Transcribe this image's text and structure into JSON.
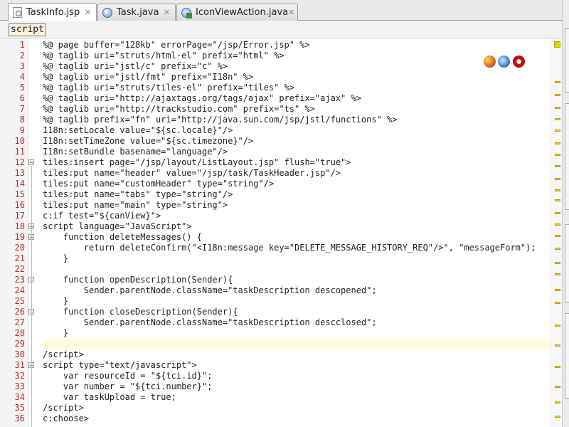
{
  "tabs": [
    {
      "label": "TaskInfo.jsp",
      "icon": "jsp-file-icon",
      "active": true
    },
    {
      "label": "Task.java",
      "icon": "java-class-icon",
      "active": false
    },
    {
      "label": "IconViewAction.java",
      "icon": "java-action-icon",
      "active": false
    }
  ],
  "close_glyph": "✕",
  "breadcrumb": "script",
  "browser_icons": [
    "firefox-icon",
    "mozilla-icon",
    "opera-icon"
  ],
  "line_numbers": [
    "1",
    "2",
    "3",
    "4",
    "5",
    "6",
    "7",
    "8",
    "9",
    "10",
    "11",
    "12",
    "13",
    "14",
    "15",
    "16",
    "17",
    "18",
    "19",
    "20",
    "21",
    "22",
    "23",
    "24",
    "25",
    "26",
    "27",
    "28",
    "29",
    "30",
    "31",
    "32",
    "33",
    "34",
    "35",
    "36"
  ],
  "code_lines": [
    "%@ page buffer=\"128kb\" errorPage=\"/jsp/Error.jsp\" %>",
    "%@ taglib uri=\"struts/html-el\" prefix=\"html\" %>",
    "%@ taglib uri=\"jstl/c\" prefix=\"c\" %>",
    "%@ taglib uri=\"jstl/fmt\" prefix=\"I18n\" %>",
    "%@ taglib uri=\"struts/tiles-el\" prefix=\"tiles\" %>",
    "%@ taglib uri=\"http://ajaxtags.org/tags/ajax\" prefix=\"ajax\" %>",
    "%@ taglib uri=\"http://trackstudio.com\" prefix=\"ts\" %>",
    "%@ taglib prefix=\"fn\" uri=\"http://java.sun.com/jsp/jstl/functions\" %>",
    "I18n:setLocale value=\"${sc.locale}\"/>",
    "I18n:setTimeZone value=\"${sc.timezone}\"/>",
    "I18n:setBundle basename=\"language\"/>",
    "tiles:insert page=\"/jsp/layout/ListLayout.jsp\" flush=\"true\">",
    "tiles:put name=\"header\" value=\"/jsp/task/TaskHeader.jsp\"/>",
    "tiles:put name=\"customHeader\" type=\"string\"/>",
    "tiles:put name=\"tabs\" type=\"string\"/>",
    "tiles:put name=\"main\" type=\"string\">",
    "c:if test=\"${canView}\">",
    "script language=\"JavaScript\">",
    "    function deleteMessages() {",
    "        return deleteConfirm(\"<I18n:message key=\"DELETE_MESSAGE_HISTORY_REQ\"/>\", \"messageForm\");",
    "    }",
    "",
    "    function openDescription(Sender){",
    "        Sender.parentNode.className=\"taskDescription descopened\";",
    "    }",
    "    function closeDescription(Sender){",
    "        Sender.parentNode.className=\"taskDescription descclosed\";",
    "    }",
    "",
    "/script>",
    "script type=\"text/javascript\">",
    "    var resourceId = \"${tci.id}\";",
    "    var number = \"${tci.number}\";",
    "    var taskUpload = true;",
    "/script>",
    "c:choose>"
  ],
  "current_line": "29"
}
